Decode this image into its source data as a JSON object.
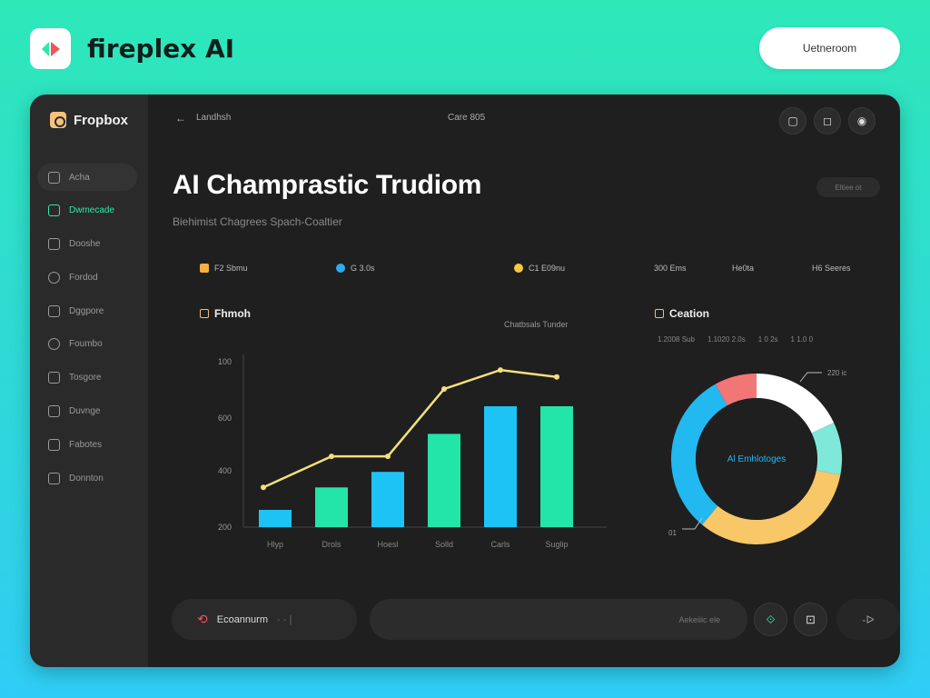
{
  "app": {
    "brand": "fireplex AI",
    "top_action": "Uetneroom"
  },
  "sidebar": {
    "brand": "Fropbox",
    "items": [
      {
        "label": "Acha",
        "icon": "bar-chart-icon",
        "state": "active"
      },
      {
        "label": "Dwmecade",
        "icon": "database-icon",
        "state": "highlight"
      },
      {
        "label": "Dooshe",
        "icon": "folder-icon",
        "state": "normal"
      },
      {
        "label": "Fordod",
        "icon": "clock-icon",
        "state": "normal"
      },
      {
        "label": "Dggpore",
        "icon": "document-icon",
        "state": "normal"
      },
      {
        "label": "Foumbo",
        "icon": "user-icon",
        "state": "normal"
      },
      {
        "label": "Tosgore",
        "icon": "image-icon",
        "state": "normal"
      },
      {
        "label": "Duvnge",
        "icon": "play-icon",
        "state": "normal"
      },
      {
        "label": "Fabotes",
        "icon": "calendar-icon",
        "state": "normal"
      },
      {
        "label": "Donnton",
        "icon": "grid-icon",
        "state": "normal"
      }
    ]
  },
  "header": {
    "breadcrumb": "Landhsh",
    "center_label": "Care 805"
  },
  "page": {
    "title": "AI Champrastic Trudiom",
    "subtitle": "Biehimist Chagrees Spach-Coaltier",
    "pill": "Eltiee ot"
  },
  "stats": [
    {
      "label": "F2 Sbmu",
      "color": "#f5b041"
    },
    {
      "label": "G 3.0s",
      "color": "#2eaaf5"
    },
    {
      "label": "C1 E09nu",
      "color": "#f5c842"
    },
    {
      "label": "300 Ems",
      "color": null
    },
    {
      "label": "He0ta",
      "color": null
    },
    {
      "label": "H6 Seeres",
      "color": null
    }
  ],
  "bar_panel": {
    "title": "Fhmoh",
    "note": "Chatbsals Tunder"
  },
  "donut_panel": {
    "title": "Ceation",
    "legend": [
      "1.2008 Sub",
      "1.1020 2.0s",
      "1 0 2s",
      "1 1.0 0"
    ],
    "center_label": "Al Emhlotoges",
    "callout_top": "220 ic",
    "callout_bottom": "01"
  },
  "chart_data": [
    {
      "type": "bar",
      "categories": [
        "Hlyp",
        "Drols",
        "Hoesl",
        "Solld",
        "Carls",
        "Suglip"
      ],
      "series": [
        {
          "values": [
            100,
            230,
            320,
            540,
            700,
            700
          ],
          "colors": [
            "#1ec3f5",
            "#24e5a8",
            "#1ec3f5",
            "#24e5a8",
            "#1ec3f5",
            "#24e5a8"
          ]
        },
        {
          "type": "line",
          "values": [
            230,
            410,
            410,
            800,
            910,
            870
          ],
          "color": "#f5e07a"
        }
      ],
      "ytick_labels": [
        "100",
        "600",
        "400",
        "200"
      ],
      "ylim": [
        0,
        1000
      ]
    },
    {
      "type": "pie",
      "segments": [
        {
          "value": 18,
          "color": "#ffffff"
        },
        {
          "value": 10,
          "color": "#7fe8d8"
        },
        {
          "value": 33,
          "color": "#f7c768"
        },
        {
          "value": 31,
          "color": "#22b8f0"
        },
        {
          "value": 8,
          "color": "#f27676"
        }
      ]
    }
  ],
  "footer": {
    "left_label": "Ecoannurm",
    "input_placeholder": "Aekeiiic ele",
    "send_label": "-ᐅ"
  }
}
